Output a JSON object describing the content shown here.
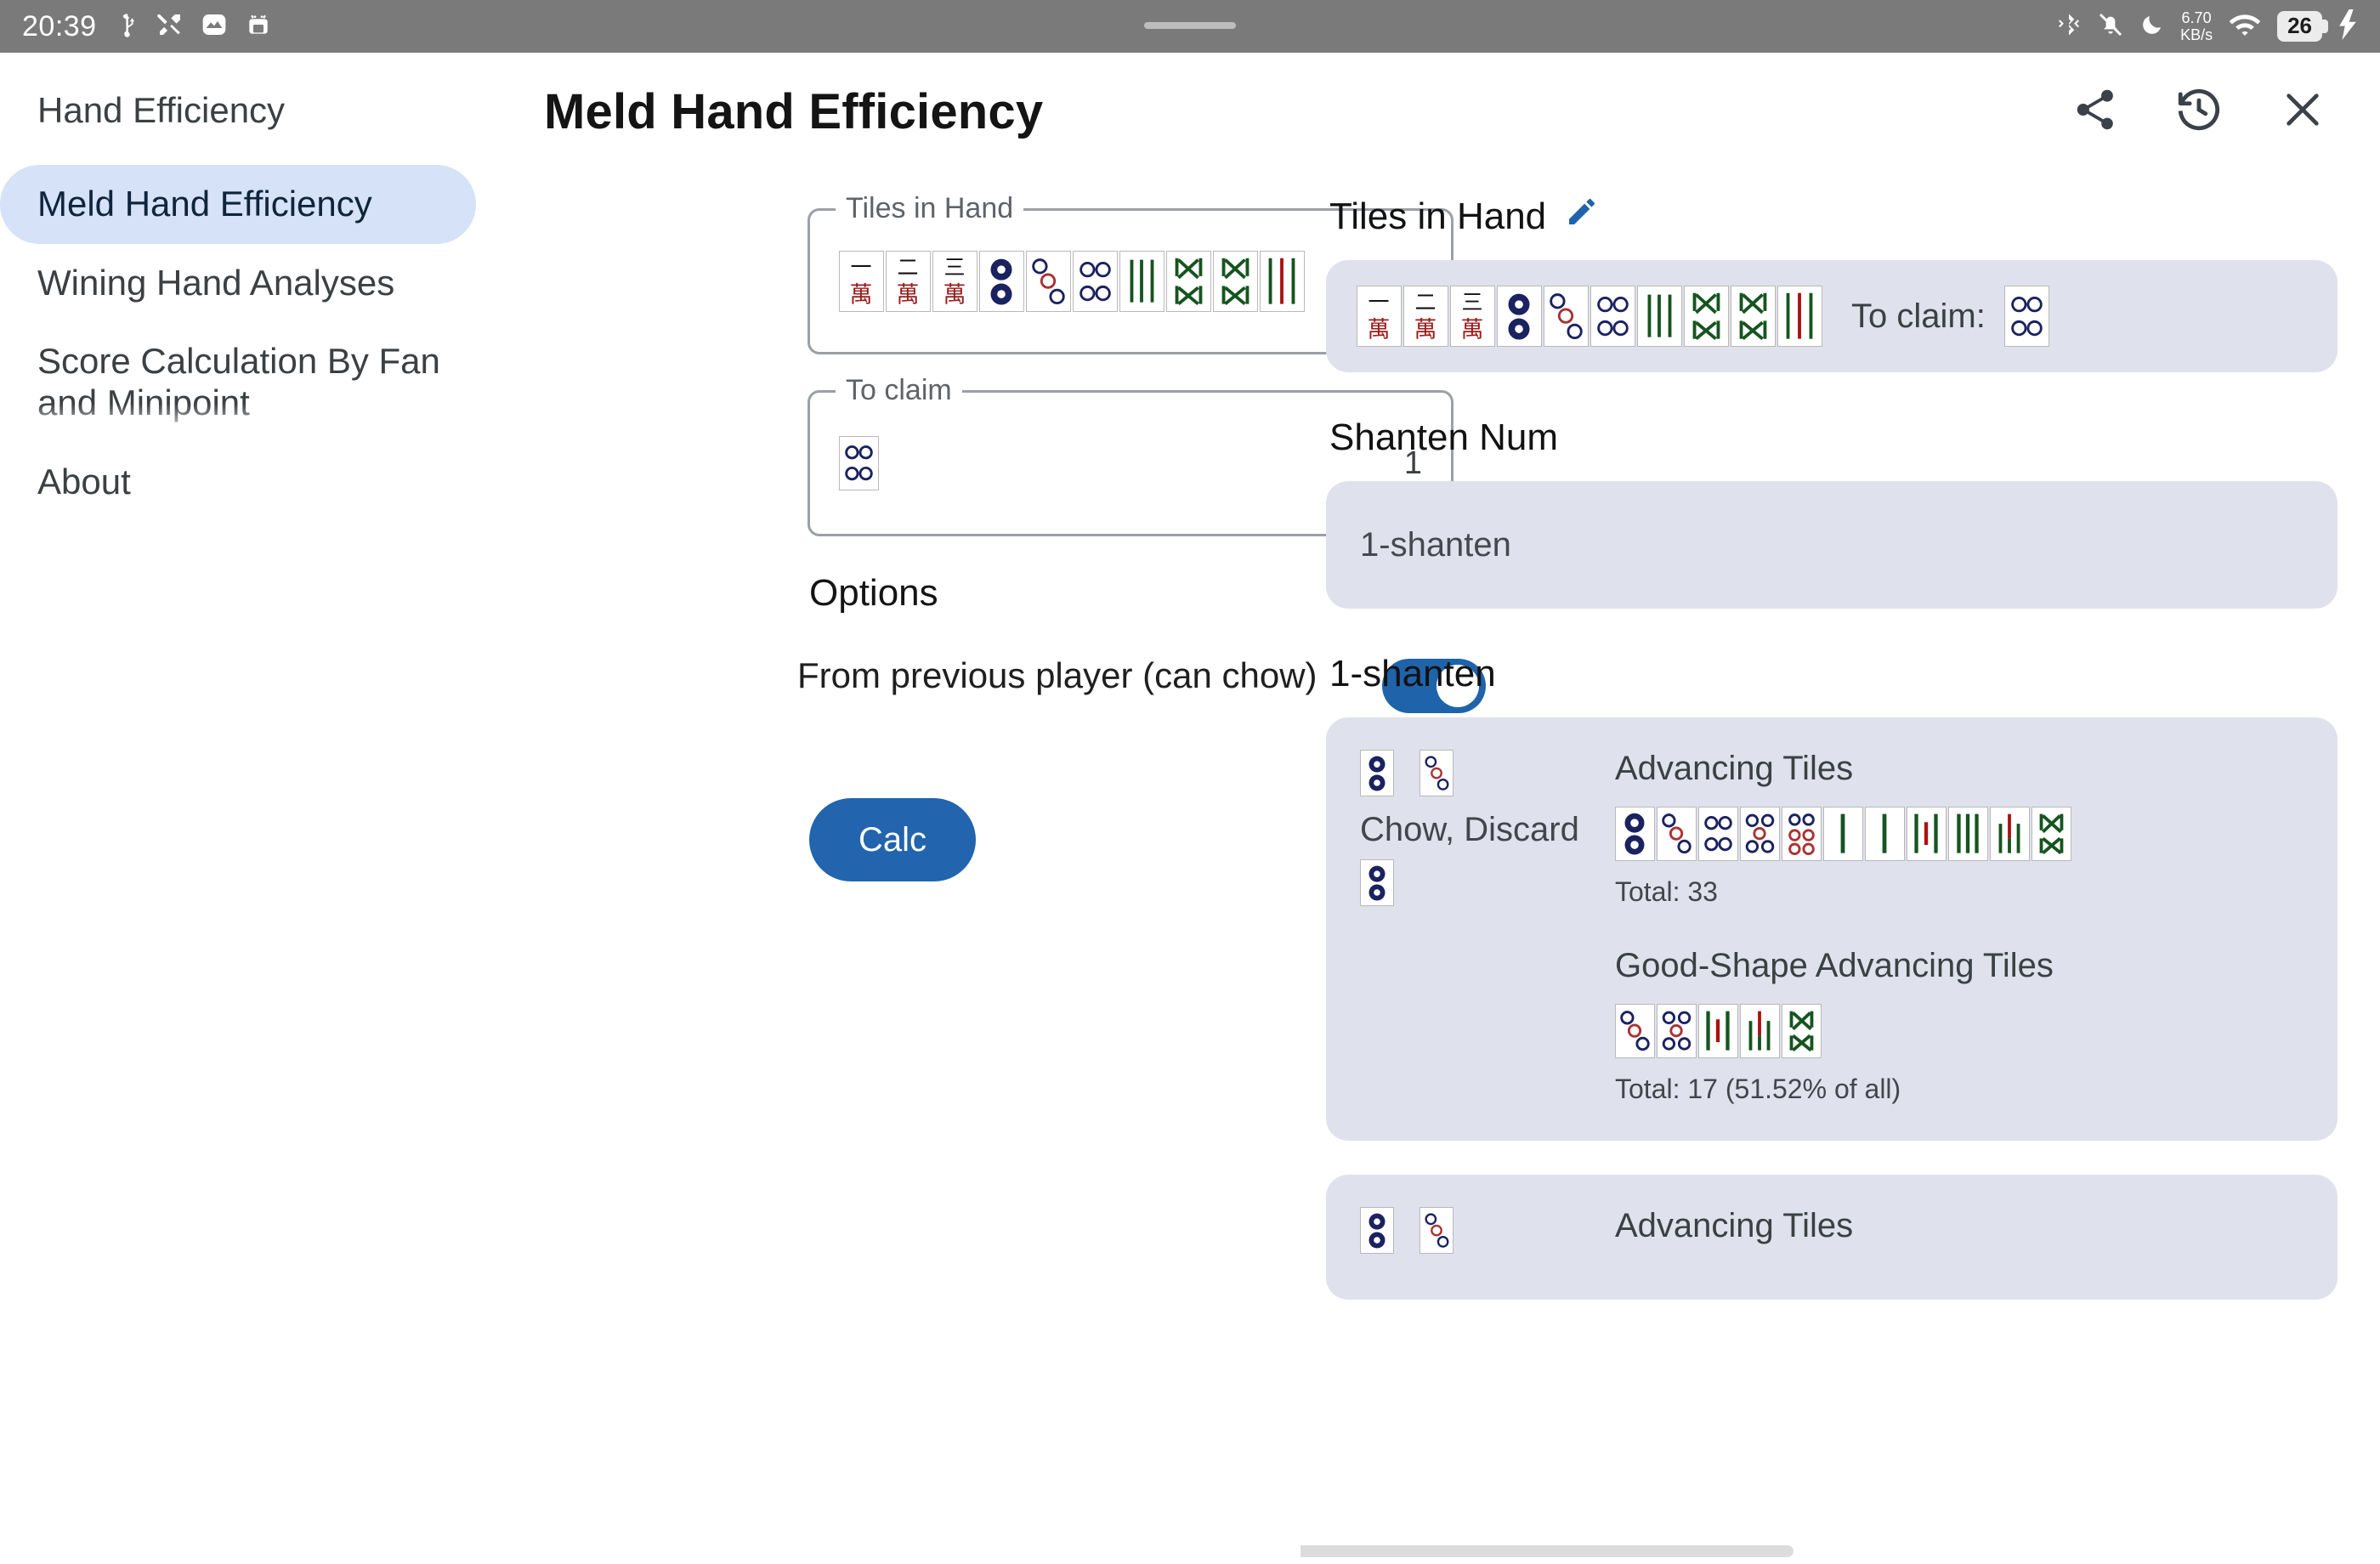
{
  "statusbar": {
    "time": "20:39",
    "left_icons": [
      "usb-icon",
      "tools-icon",
      "image-icon",
      "android-icon"
    ],
    "data_rate_value": "6.70",
    "data_rate_unit": "KB/s",
    "battery_percent": "26",
    "right_icons": [
      "bluetooth-icon",
      "notifications-muted-icon",
      "do-not-disturb-icon",
      "wifi-icon",
      "battery-icon",
      "charging-bolt-icon"
    ]
  },
  "sidebar": {
    "title": "Hand Efficiency",
    "items": [
      {
        "label": "Meld Hand Efficiency",
        "selected": true
      },
      {
        "label": "Wining Hand Analyses",
        "selected": false
      },
      {
        "label": "Score Calculation By Fan and Minipoint",
        "selected": false
      },
      {
        "label": "About",
        "selected": false
      }
    ]
  },
  "header": {
    "title": "Meld Hand Efficiency",
    "actions": [
      {
        "name": "share-icon",
        "label": "Share"
      },
      {
        "name": "history-icon",
        "label": "History"
      },
      {
        "name": "close-icon",
        "label": "Close"
      }
    ]
  },
  "form": {
    "tiles_in_hand": {
      "label": "Tiles in Hand",
      "count": "10",
      "tiles": [
        "1m",
        "2m",
        "3m",
        "1p",
        "3p",
        "4p",
        "3s",
        "5s",
        "5s",
        "6s"
      ]
    },
    "to_claim": {
      "label": "To claim",
      "count": "1",
      "tiles": [
        "4p"
      ]
    },
    "options_title": "Options",
    "option_chow": {
      "label": "From previous player (can chow)",
      "enabled": true
    },
    "calc_label": "Calc"
  },
  "result": {
    "tiles_in_hand_heading": "Tiles in Hand",
    "edit_icon": "pencil-icon",
    "hand_tiles": [
      "1m",
      "2m",
      "3m",
      "1p",
      "3p",
      "4p",
      "3s",
      "5s",
      "5s",
      "6s"
    ],
    "to_claim_label": "To claim:",
    "to_claim_tiles": [
      "4p"
    ],
    "shanten_heading": "Shanten Num",
    "shanten_value": "1-shanten",
    "group_heading": "1-shanten",
    "cards": [
      {
        "meld_tiles": [
          "1p",
          "3p"
        ],
        "action_text": "Chow, Discard",
        "discard_tiles": [
          "1p"
        ],
        "advancing_heading": "Advancing Tiles",
        "advancing_tiles": [
          "1p",
          "3p",
          "4p",
          "5p",
          "6p",
          "1s",
          "2s",
          "3s",
          "4s",
          "5s",
          "6s"
        ],
        "advancing_total": "Total: 33",
        "good_shape_heading": "Good-Shape Advancing Tiles",
        "good_shape_tiles": [
          "3p",
          "4p",
          "3s",
          "4s",
          "5s"
        ],
        "good_shape_total": "Total: 17 (51.52% of all)"
      },
      {
        "meld_tiles": [
          "1p",
          "3p"
        ],
        "advancing_heading": "Advancing Tiles"
      }
    ]
  },
  "colors": {
    "accent": "#2264ad",
    "selected_nav_bg": "#d5e2f7",
    "card_bg": "#dfe2ec",
    "statusbar_bg": "#7a7a7a"
  }
}
